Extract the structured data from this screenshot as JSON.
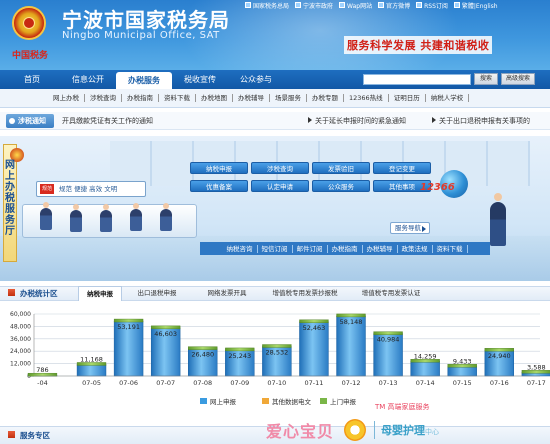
{
  "header": {
    "title_cn": "宁波市国家税务局",
    "title_en": "Ningbo Municipal Office, SAT",
    "logo_text": "中国税务",
    "slogan": "服务科学发展  共建和谐税收",
    "top_links": [
      {
        "label": "国家税务总局",
        "icon": "emblem-icon"
      },
      {
        "label": "宁波市政府",
        "icon": "emblem-icon"
      },
      {
        "label": "Wap网站",
        "icon": "mobile-icon"
      },
      {
        "label": "官方微博",
        "icon": "weibo-icon"
      },
      {
        "label": "RSS订阅",
        "icon": "rss-icon"
      },
      {
        "label": "繁體|English",
        "icon": "language-icon"
      }
    ]
  },
  "nav": {
    "items": [
      "首页",
      "信息公开",
      "办税服务",
      "税收宣传",
      "公众参与"
    ],
    "active_index": 2,
    "search_value": "",
    "search_button": "搜索",
    "advanced_button": "高级搜索"
  },
  "subnav": {
    "items": [
      "网上办税",
      "涉税查询",
      "办税指南",
      "资料下载",
      "办税地图",
      "办税辅导",
      "场景服务",
      "办税专题",
      "12366热线",
      "证明日历",
      "纳税人学校"
    ]
  },
  "notice": {
    "badge": "涉税通知",
    "items": [
      "开具缴款凭证有关工作的通知",
      "关于延长申报时间的紧急通知",
      "关于出口退税申报有关事项的"
    ]
  },
  "banner": {
    "vertical_text": "网上办税服务厅",
    "sign_logo": "规范",
    "sign_text": "规范 便捷 高效 文明",
    "pills": [
      "纳税申报",
      "涉税查询",
      "发票验旧",
      "登记变更",
      "优惠备案",
      "认定申请",
      "公众服务",
      "其他事项"
    ],
    "guide_label": "服务导航",
    "hotline": "12366",
    "bottom_links": [
      "纳税咨询",
      "短信订阅",
      "邮件订阅",
      "办税指南",
      "办税辅导",
      "政策法规",
      "资料下载"
    ]
  },
  "stats": {
    "title": "办税统计区",
    "tabs": [
      "纳税申报",
      "出口退税申报",
      "网络发票开具",
      "增值税专用发票抄报税",
      "增值税专用发票认证"
    ],
    "active_tab": 0
  },
  "chart_data": {
    "type": "bar",
    "categories": [
      "07-04",
      "07-05",
      "07-06",
      "07-07",
      "07-08",
      "07-09",
      "07-10",
      "07-11",
      "07-12",
      "07-13",
      "07-14",
      "07-15",
      "07-16",
      "07-17"
    ],
    "series": [
      {
        "name": "网上申报",
        "values": [
          786,
          11168,
          53191,
          46603,
          26480,
          25243,
          28532,
          52463,
          58148,
          40984,
          14259,
          9433,
          24940,
          3588
        ],
        "color": "#3a9be0"
      },
      {
        "name": "其他数据电文",
        "values": [
          0,
          0,
          0,
          0,
          0,
          0,
          0,
          0,
          0,
          0,
          0,
          0,
          0,
          0
        ],
        "color": "#f0a838"
      },
      {
        "name": "上门申报",
        "values": [
          0,
          0,
          0,
          0,
          0,
          0,
          0,
          0,
          0,
          0,
          0,
          0,
          0,
          0
        ],
        "color": "#7ab648"
      }
    ],
    "value_labels": [
      "786",
      "11,168",
      "53,191",
      "46,603",
      "26,480",
      "25,243",
      "28,532",
      "52,463",
      "58,148",
      "40,984",
      "14,259",
      "9,433",
      "24,940",
      "3,588"
    ],
    "tick_labels_x": [
      "-04",
      "07-05",
      "07-06",
      "07-07",
      "07-08",
      "07-09",
      "07-10",
      "07-11",
      "07-12",
      "07-13",
      "07-14",
      "07-15",
      "07-16",
      "07-17"
    ],
    "y_ticks": [
      0,
      12000,
      24000,
      36000,
      48000,
      60000
    ],
    "y_tick_labels": [
      "0",
      "12,000",
      "24,000",
      "36,000",
      "48,000",
      "60,000"
    ],
    "ylim": [
      0,
      60000
    ],
    "grid": true,
    "legend_position": "bottom"
  },
  "footer": {
    "title": "服务专区"
  },
  "watermark": {
    "text_cn": "爱心宝贝",
    "sub_text": "TM 高端家庭服务",
    "right_text": "母婴护理",
    "right_small": "中心"
  }
}
